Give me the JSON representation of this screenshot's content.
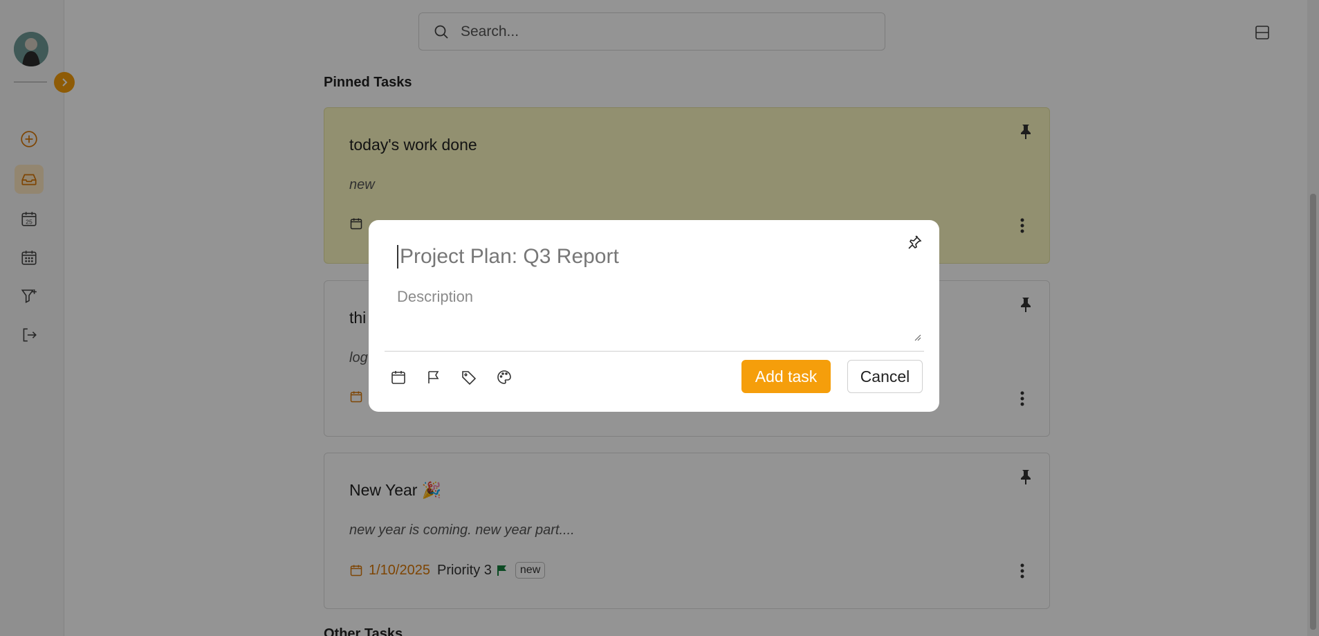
{
  "search": {
    "placeholder": "Search..."
  },
  "sidebar": {
    "nav": [
      "add-task",
      "inbox",
      "today",
      "upcoming",
      "filters",
      "logout"
    ],
    "today_number": "25"
  },
  "sections": {
    "pinned_title": "Pinned Tasks",
    "other_title": "Other Tasks"
  },
  "tasks": [
    {
      "title": "today's work done",
      "description": "new",
      "date": "",
      "priority": "",
      "tag": ""
    },
    {
      "title": "thi",
      "description": "log",
      "date": "",
      "priority": "",
      "tag": ""
    },
    {
      "title": "New Year 🎉",
      "description": "new year is coming. new year part....",
      "date": "1/10/2025",
      "priority": "Priority 3",
      "tag": "new"
    }
  ],
  "modal": {
    "title_value": "Project Plan: Q3 Report",
    "description_placeholder": "Description",
    "add_label": "Add task",
    "cancel_label": "Cancel"
  },
  "colors": {
    "accent": "#f59e0b",
    "pinned_card_bg": "#fbf8c2",
    "date_text": "#d97706",
    "priority_flag": "#15803d"
  }
}
